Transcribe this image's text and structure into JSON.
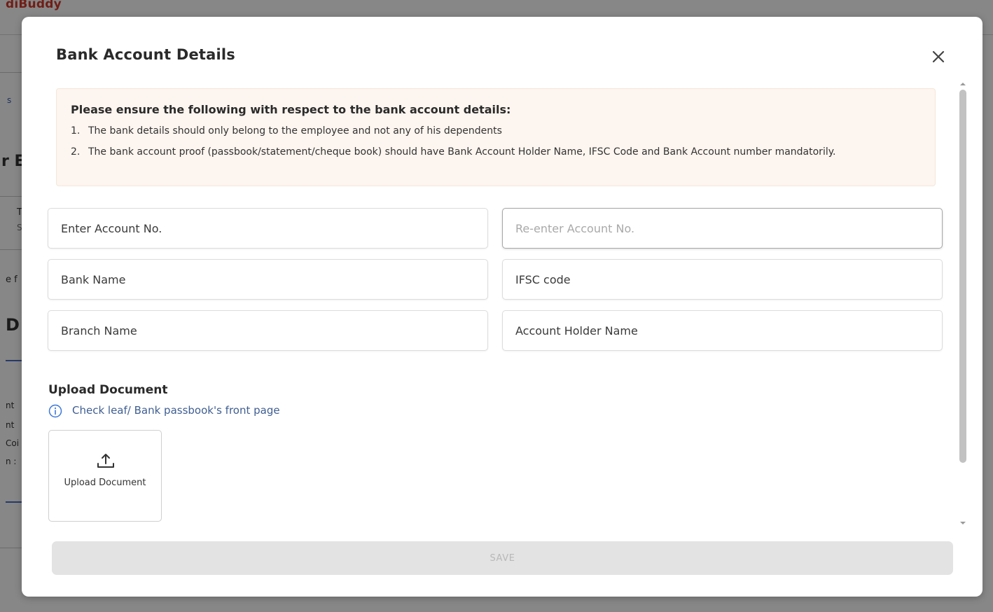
{
  "background": {
    "logo_text": "diBuddy",
    "fragments": [
      "s",
      "r E",
      "T",
      "S",
      "e f",
      "D",
      "nt",
      "nt",
      "Coi",
      "n :"
    ]
  },
  "modal": {
    "title": "Bank Account Details",
    "close_icon": "close-icon"
  },
  "notice": {
    "title": "Please ensure the following with respect to the bank account details:",
    "items": [
      {
        "num": "1.",
        "text": "The bank details should only belong to the employee and not any of his dependents"
      },
      {
        "num": "2.",
        "text": "The bank account proof (passbook/statement/cheque book) should have Bank Account Holder Name, IFSC Code and Bank Account number mandatorily."
      }
    ]
  },
  "form": {
    "account_no": {
      "placeholder": "Enter Account No.",
      "value": ""
    },
    "reenter_account_no": {
      "placeholder": "Re-enter Account No.",
      "value": ""
    },
    "bank_name": {
      "placeholder": "Bank Name",
      "value": ""
    },
    "ifsc_code": {
      "placeholder": "IFSC code",
      "value": ""
    },
    "branch_name": {
      "placeholder": "Branch Name",
      "value": ""
    },
    "account_holder_name": {
      "placeholder": "Account Holder Name",
      "value": ""
    }
  },
  "upload": {
    "heading": "Upload Document",
    "hint_icon": "info-icon",
    "hint": "Check leaf/ Bank passbook's front page",
    "button_icon": "upload-icon",
    "button_label": "Upload Document"
  },
  "actions": {
    "save_label": "SAVE"
  },
  "colors": {
    "notice_bg": "#fdf5ef",
    "hint_text": "#3f5e92",
    "info_icon": "#3c78d8",
    "save_disabled_bg": "#e3e3e3",
    "save_disabled_text": "#b8b8b8"
  }
}
